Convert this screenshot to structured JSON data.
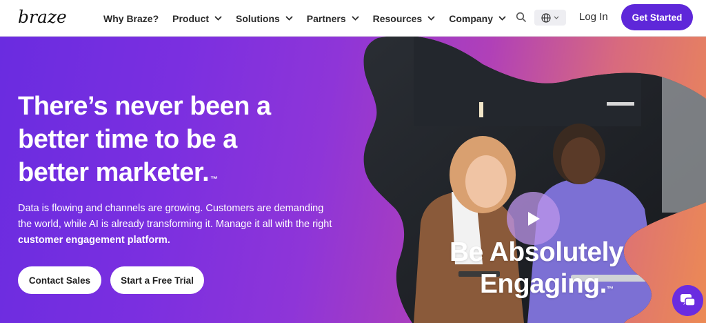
{
  "header": {
    "logo_text": "braze",
    "nav": [
      {
        "label": "Why Braze?",
        "has_dropdown": false
      },
      {
        "label": "Product",
        "has_dropdown": true
      },
      {
        "label": "Solutions",
        "has_dropdown": true
      },
      {
        "label": "Partners",
        "has_dropdown": true
      },
      {
        "label": "Resources",
        "has_dropdown": true
      },
      {
        "label": "Company",
        "has_dropdown": true
      }
    ],
    "login_label": "Log In",
    "cta_label": "Get Started"
  },
  "hero": {
    "headline": "There’s never been a better time to be a better marketer.",
    "trademark": "™",
    "body_plain": "Data is flowing and channels are growing. Customers are demanding the world, while AI is already transforming it. Manage it all with the right ",
    "body_bold": "customer engagement platform.",
    "button_sales": "Contact Sales",
    "button_trial": "Start a Free Trial",
    "video_title_line1": "Be Absolutely",
    "video_title_line2": "Engaging.",
    "video_trademark": "™"
  },
  "colors": {
    "brand_purple": "#5e27d9",
    "hero_gradient_start": "#6a2ce0",
    "hero_gradient_end": "#ec8a54"
  },
  "icons": {
    "search": "search-icon",
    "language": "globe-icon",
    "play": "play-icon",
    "chat": "chat-icon"
  }
}
